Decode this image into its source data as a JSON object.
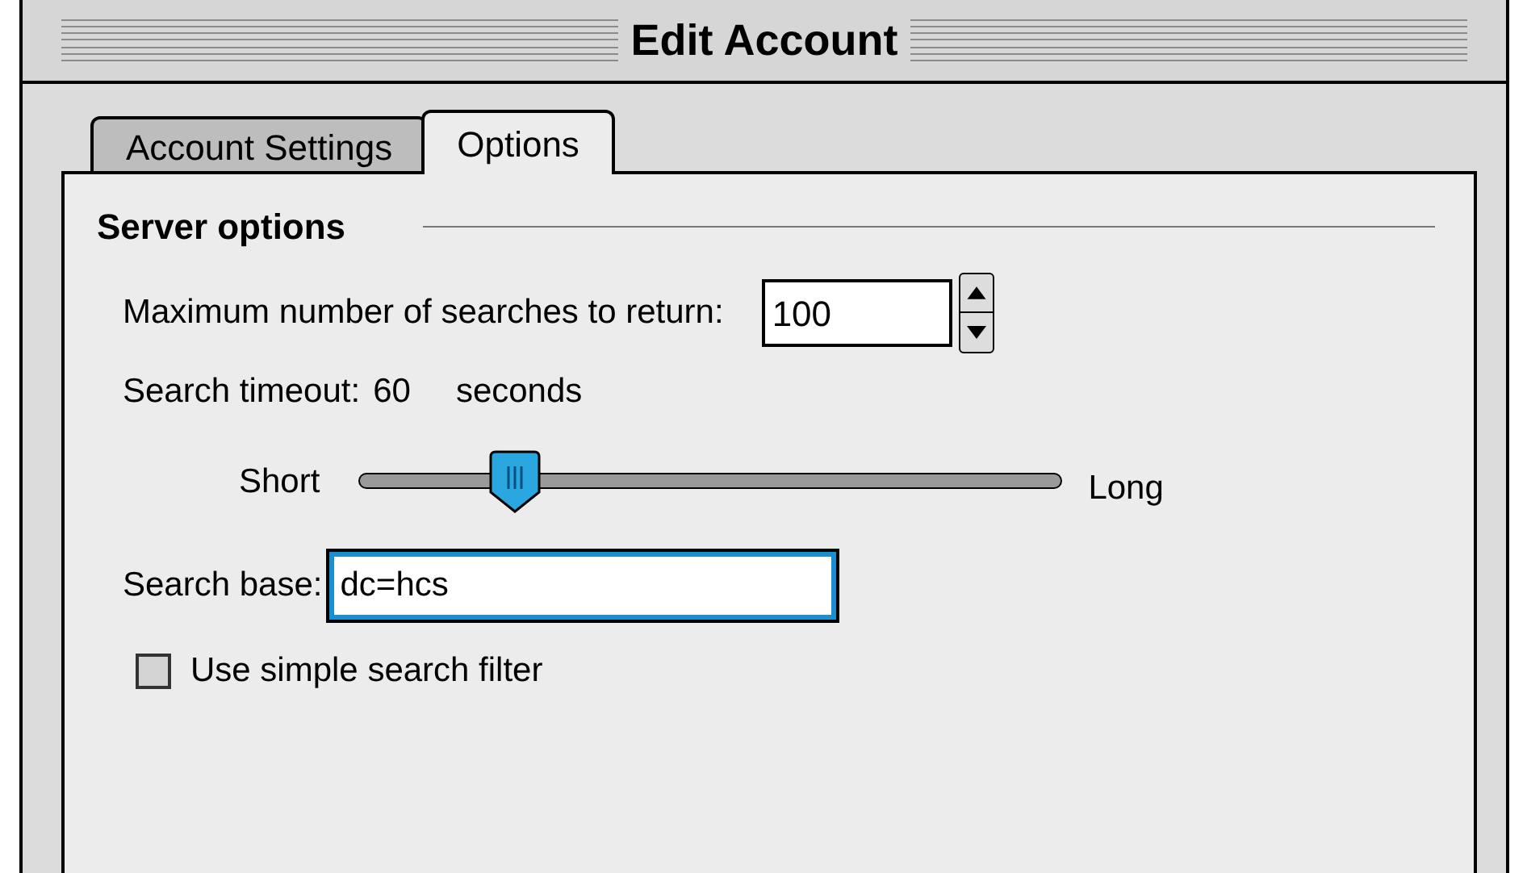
{
  "window": {
    "title": "Edit Account"
  },
  "tabs": [
    {
      "label": "Account Settings",
      "selected": false
    },
    {
      "label": "Options",
      "selected": true
    }
  ],
  "section": {
    "title": "Server options"
  },
  "max_searches": {
    "label": "Maximum number of searches to return:",
    "value": "100"
  },
  "timeout": {
    "label": "Search timeout:",
    "value": "60",
    "unit": "seconds"
  },
  "slider": {
    "min_label": "Short",
    "max_label": "Long",
    "level": 0.22
  },
  "search_base": {
    "label": "Search base:",
    "value": "dc=hcs",
    "focused": true
  },
  "simple_filter": {
    "label": "Use simple search filter",
    "checked": false
  }
}
